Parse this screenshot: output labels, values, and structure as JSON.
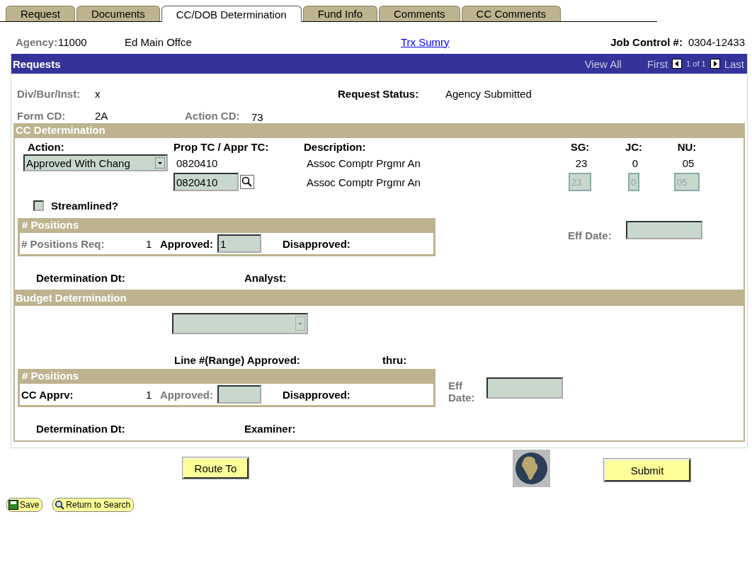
{
  "tabs": [
    {
      "label": "Request",
      "selected": false
    },
    {
      "label": "Documents",
      "selected": false
    },
    {
      "label": "CC/DOB Determination",
      "selected": true
    },
    {
      "label": "Fund Info",
      "selected": false
    },
    {
      "label": "Comments",
      "selected": false
    },
    {
      "label": "CC Comments",
      "selected": false
    }
  ],
  "header": {
    "agency_label": "Agency:",
    "agency_value": "11000",
    "agency_name": "Ed Main Offce",
    "link": "Trx Sumry",
    "job_control_label": "Job Control #:",
    "job_control_value": "0304-12433"
  },
  "requests": {
    "title": "Requests",
    "view_all": "View All",
    "first": "First",
    "page": "1 of 1",
    "last": "Last",
    "div_label": "Div/Bur/Inst:",
    "div_value": "x",
    "status_label": "Request Status:",
    "status_value": "Agency Submitted",
    "form_label": "Form CD:",
    "form_value": "2A",
    "action_label": "Action CD:",
    "action_value": "73"
  },
  "cc_determination": {
    "title": "CC Determination",
    "columns": [
      "Action:",
      "Prop TC / Appr TC:",
      "Description:",
      "SG:",
      "JC:",
      "NU:"
    ],
    "action": "Approved With Chang",
    "prop_tc": "0820410",
    "appr_tc": "0820410",
    "descriptions": [
      "Assoc Comptr Prgmr An",
      "Assoc Comptr Prgmr An"
    ],
    "values": [
      "23",
      "0",
      "05"
    ],
    "inputs": [
      {
        "value": "23",
        "disabled": true
      },
      {
        "value": "0",
        "disabled": true
      },
      {
        "value": "05",
        "disabled": true
      }
    ],
    "streamlined": {
      "label": "Streamlined?",
      "checked": false
    },
    "positions": {
      "title": "# Positions",
      "req_label": "# Positions Req:",
      "req_value": "1",
      "approved_label": "Approved:",
      "approved_value": "1",
      "approved_disabled": false,
      "disapproved_label": "Disapproved:"
    },
    "eff_date_label": "Eff Date:",
    "determination_label": "Determination Dt:",
    "person_label": "Analyst:"
  },
  "budget_determination": {
    "title": "Budget Determination",
    "line_label": "Line #(Range) Approved:",
    "thru_label": "thru:",
    "positions": {
      "title": "# Positions",
      "req_label": "CC Apprv:",
      "req_value": "1",
      "approved_label": "Approved:",
      "approved_disabled": true,
      "disapproved_label": "Disapproved:"
    },
    "eff_date_label": "Eff Date:",
    "determination_label": "Determination Dt:",
    "person_label": "Examiner:"
  },
  "buttons": {
    "route_to": "Route To",
    "submit": "Submit",
    "save": "Save",
    "return": "Return to Search"
  }
}
